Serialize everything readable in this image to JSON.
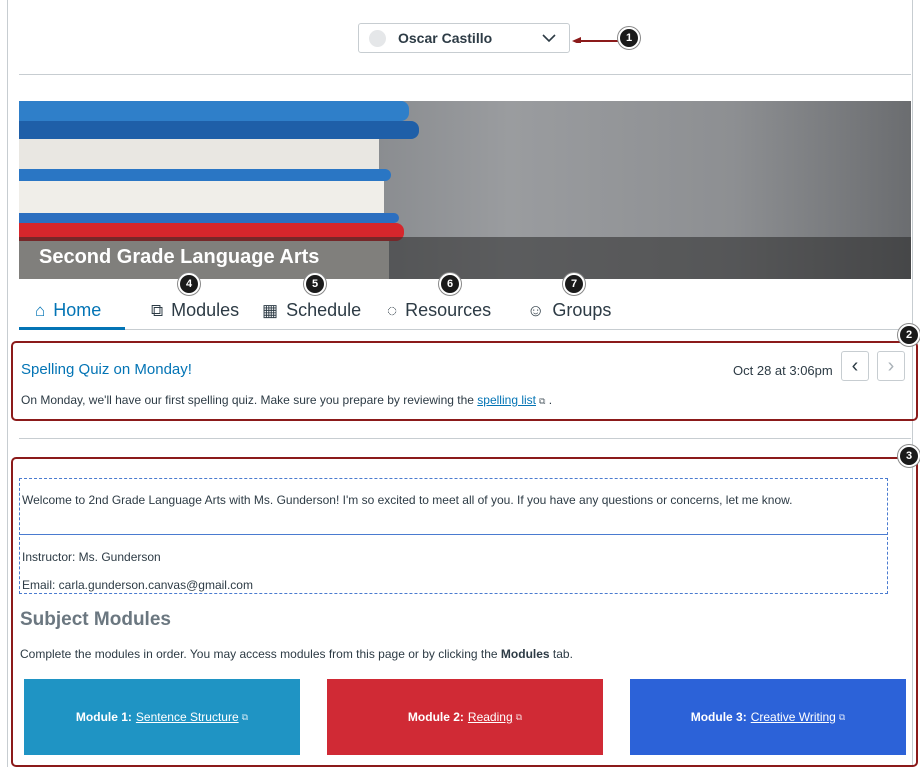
{
  "student_selector": {
    "name": "Oscar Castillo"
  },
  "callouts": {
    "c1": "1",
    "c2": "2",
    "c3": "3",
    "c4": "4",
    "c5": "5",
    "c6": "6",
    "c7": "7"
  },
  "hero": {
    "title": "Second Grade Language Arts"
  },
  "tabs": [
    {
      "label": "Home",
      "icon": "home-icon"
    },
    {
      "label": "Modules",
      "icon": "modules-icon"
    },
    {
      "label": "Schedule",
      "icon": "calendar-icon"
    },
    {
      "label": "Resources",
      "icon": "resources-icon"
    },
    {
      "label": "Groups",
      "icon": "groups-icon"
    }
  ],
  "announcement": {
    "title": "Spelling Quiz on Monday!",
    "date": "Oct 28 at 3:06pm",
    "body_before": "On Monday, we'll have our first spelling quiz. Make sure you prepare by reviewing the ",
    "link": "spelling list",
    "body_after": " ."
  },
  "home": {
    "welcome": "Welcome to 2nd Grade Language Arts with Ms. Gunderson! I'm so excited to meet all of you. If you have any questions or concerns, let me know.",
    "instructor": "Instructor: Ms. Gunderson",
    "email": "Email: carla.gunderson.canvas@gmail.com",
    "subject_heading": "Subject Modules",
    "subject_desc_before": "Complete the modules in order. You may access modules from this page or by clicking the ",
    "subject_desc_bold": "Modules",
    "subject_desc_after": " tab.",
    "modules": [
      {
        "prefix": "Module 1:",
        "link": "Sentence Structure",
        "color": "#1f94c4"
      },
      {
        "prefix": "Module 2:",
        "link": "Reading",
        "color": "#d02a35"
      },
      {
        "prefix": "Module 3:",
        "link": "Creative Writing",
        "color": "#2c62d8"
      }
    ]
  },
  "colors": {
    "accent": "#0374b5",
    "callout_border": "#8b1a1a"
  }
}
